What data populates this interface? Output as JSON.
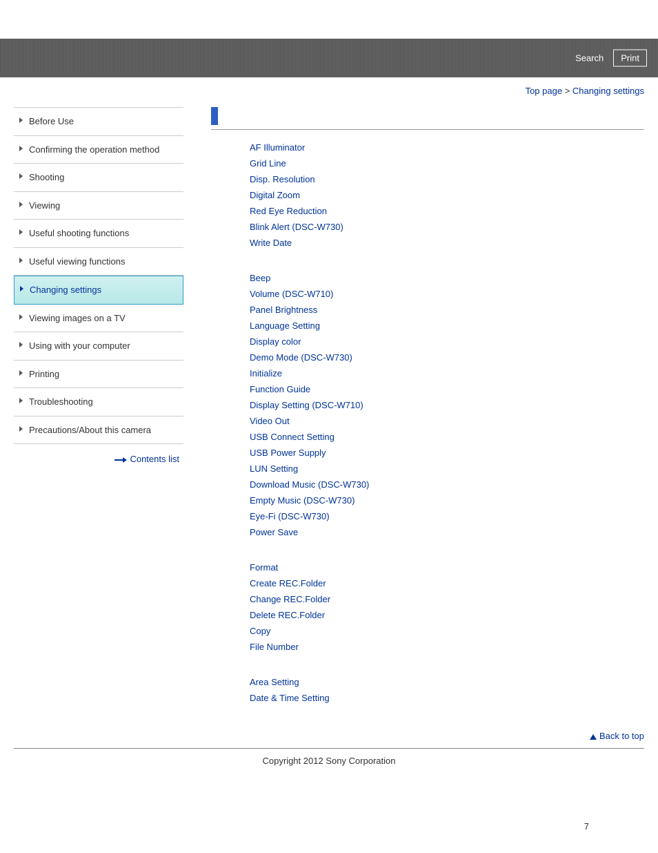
{
  "header": {
    "search": "Search",
    "print": "Print"
  },
  "breadcrumb": {
    "top": "Top page",
    "sep": ">",
    "current": "Changing settings"
  },
  "sidebar": {
    "items": [
      {
        "label": "Before Use"
      },
      {
        "label": "Confirming the operation method"
      },
      {
        "label": "Shooting"
      },
      {
        "label": "Viewing"
      },
      {
        "label": "Useful shooting functions"
      },
      {
        "label": "Useful viewing functions"
      },
      {
        "label": "Changing settings"
      },
      {
        "label": "Viewing images on a TV"
      },
      {
        "label": "Using with your computer"
      },
      {
        "label": "Printing"
      },
      {
        "label": "Troubleshooting"
      },
      {
        "label": "Precautions/About this camera"
      }
    ],
    "active_index": 6,
    "contents_list": "Contents list"
  },
  "sections": [
    {
      "links": [
        "AF Illuminator",
        "Grid Line",
        "Disp. Resolution",
        "Digital Zoom",
        "Red Eye Reduction",
        "Blink Alert (DSC-W730)",
        "Write Date"
      ]
    },
    {
      "links": [
        "Beep",
        "Volume (DSC-W710)",
        "Panel Brightness",
        "Language Setting",
        "Display color",
        "Demo Mode (DSC-W730)",
        "Initialize",
        "Function Guide",
        "Display Setting (DSC-W710)",
        "Video Out",
        "USB Connect Setting",
        "USB Power Supply",
        "LUN Setting",
        "Download Music (DSC-W730)",
        "Empty Music (DSC-W730)",
        "Eye-Fi (DSC-W730)",
        "Power Save"
      ]
    },
    {
      "links": [
        "Format",
        "Create REC.Folder",
        "Change REC.Folder",
        "Delete REC.Folder",
        "Copy",
        "File Number"
      ]
    },
    {
      "links": [
        "Area Setting",
        "Date & Time Setting"
      ]
    }
  ],
  "back_to_top": "Back to top",
  "copyright": "Copyright 2012 Sony Corporation",
  "page_number": "7"
}
